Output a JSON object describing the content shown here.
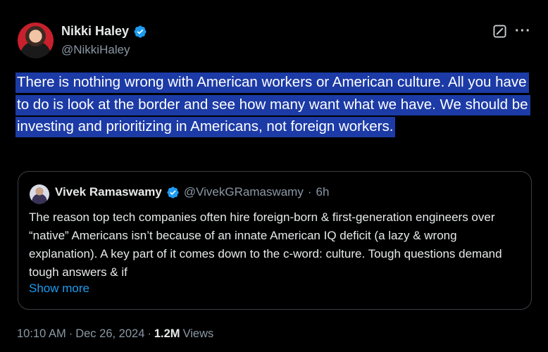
{
  "tweet": {
    "author_name": "Nikki Haley",
    "author_handle": "@NikkiHaley",
    "text": "There is nothing wrong with American workers or American culture. All you have to do is look at the border and see how many want what we have. We should be investing and prioritizing in Americans, not foreign workers.",
    "highlight_color": "#1c3ba6"
  },
  "quote": {
    "author_name": "Vivek Ramaswamy",
    "author_handle": "@VivekGRamaswamy",
    "separator": "·",
    "age": "6h",
    "text": "The reason top tech companies often hire foreign-born & first-generation engineers over “native” Americans isn’t because of an innate American IQ deficit (a lazy & wrong explanation). A key part of it comes down to the c-word: culture. Tough questions demand tough answers & if",
    "show_more_label": "Show more"
  },
  "meta": {
    "time": "10:10 AM",
    "dot1": "·",
    "date": "Dec 26, 2024",
    "dot2": "·",
    "views_count": "1.2M",
    "views_label": "Views"
  },
  "icons": {
    "verified": "verified-badge-icon",
    "edit": "grok-edit-icon",
    "more": "more-dots-icon"
  },
  "colors": {
    "background": "#000000",
    "verified_blue": "#1d9bf0",
    "link_blue": "#1d9bf0",
    "secondary_text": "#8b98a5"
  }
}
